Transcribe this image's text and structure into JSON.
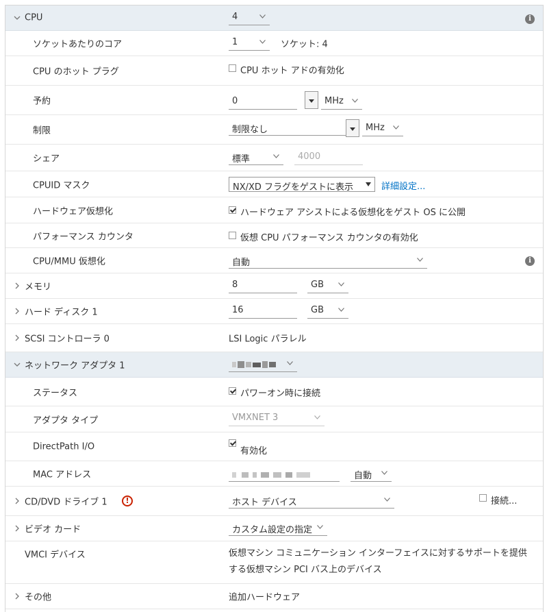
{
  "cpu": {
    "label": "CPU",
    "value": "4",
    "cores_label": "ソケットあたりのコア",
    "cores_value": "1",
    "sockets_text": "ソケット: 4",
    "hotplug_label": "CPU のホット プラグ",
    "hotplug_cb": "CPU ホット アドの有効化",
    "reservation_label": "予約",
    "reservation_value": "0",
    "reservation_unit": "MHz",
    "limit_label": "制限",
    "limit_value": "制限なし",
    "limit_unit": "MHz",
    "shares_label": "シェア",
    "shares_value": "標準",
    "shares_num": "4000",
    "cpuid_label": "CPUID マスク",
    "cpuid_value": "NX/XD フラグをゲストに表示",
    "cpuid_link": "詳細設定...",
    "hwvirt_label": "ハードウェア仮想化",
    "hwvirt_cb": "ハードウェア アシストによる仮想化をゲスト OS に公開",
    "perf_label": "パフォーマンス カウンタ",
    "perf_cb": "仮想 CPU パフォーマンス カウンタの有効化",
    "mmu_label": "CPU/MMU 仮想化",
    "mmu_value": "自動"
  },
  "memory": {
    "label": "メモリ",
    "value": "8",
    "unit": "GB"
  },
  "disk": {
    "label": "ハード ディスク 1",
    "value": "16",
    "unit": "GB"
  },
  "scsi": {
    "label": "SCSI コントローラ 0",
    "value": "LSI Logic パラレル"
  },
  "network": {
    "label": "ネットワーク アダプタ 1",
    "status_label": "ステータス",
    "status_cb": "パワーオン時に接続",
    "type_label": "アダプタ タイプ",
    "type_value": "VMXNET 3",
    "dp_label": "DirectPath I/O",
    "dp_cb": "有効化",
    "mac_label": "MAC アドレス",
    "mac_mode": "自動"
  },
  "cddvd": {
    "label": "CD/DVD ドライブ 1",
    "value": "ホスト デバイス",
    "connect": "接続..."
  },
  "video": {
    "label": "ビデオ カード",
    "value": "カスタム設定の指定"
  },
  "vmci": {
    "label": "VMCI デバイス",
    "desc1": "仮想マシン コミュニケーション インターフェイスに対するサポートを提供",
    "desc2": "する仮想マシン PCI バス上のデバイス"
  },
  "other": {
    "label": "その他",
    "value": "追加ハードウェア"
  }
}
